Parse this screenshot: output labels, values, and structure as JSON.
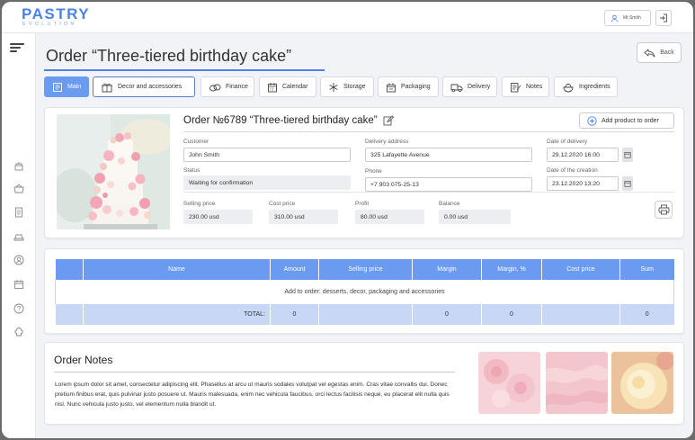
{
  "app": {
    "logo_main": "PASTRY",
    "logo_sub": "EVOLUTION"
  },
  "header": {
    "user_name": "Mr.Smith"
  },
  "page": {
    "title": "Order “Three-tiered birthday cake”",
    "back_label": "Back"
  },
  "tabs": [
    {
      "label": "Main",
      "icon": "order-icon",
      "active": true
    },
    {
      "label": "Decor and accessories",
      "icon": "gift-icon"
    },
    {
      "label": "Finance",
      "icon": "money-icon"
    },
    {
      "label": "Calendar",
      "icon": "calendar-icon"
    },
    {
      "label": "Storage",
      "icon": "snowflake-icon"
    },
    {
      "label": "Packaging",
      "icon": "box-icon"
    },
    {
      "label": "Delivery",
      "icon": "truck-icon"
    },
    {
      "label": "Notes",
      "icon": "notes-icon"
    },
    {
      "label": "Ingredients",
      "icon": "ingredients-icon"
    }
  ],
  "order": {
    "heading": "Order №6789  “Three-tiered birthday cake”",
    "add_product_label": "Add product to order",
    "customer_label": "Customer",
    "customer": "John Smith",
    "status_label": "Status",
    "status": "Waiting for confirmation",
    "address_label": "Delivery address",
    "address": "325 Lafayette Avenue",
    "phone_label": "Phone",
    "phone": "+7 903 075-25-13",
    "delivery_date_label": "Date of delivery",
    "delivery_date": "29.12.2020   16:00",
    "creation_date_label": "Date of the creation",
    "creation_date": "23.12.2020   13:20",
    "selling_price_label": "Selling price",
    "selling_price": "230.00 usd",
    "cost_price_label": "Cost price",
    "cost_price": "310.00 usd",
    "profit_label": "Profit",
    "profit": "80.00 usd",
    "balance_label": "Balance",
    "balance": "0.00 usd"
  },
  "products_table": {
    "columns": [
      "",
      "Name",
      "Amount",
      "Selling price",
      "Margin",
      "Margin, %",
      "Cost price",
      "Sum"
    ],
    "empty_message": "Add to order: desserts, decor, packaging and accessories",
    "total_label": "TOTAL:",
    "totals": {
      "amount": "0",
      "margin": "0",
      "margin_pct": "0",
      "sum": "0"
    }
  },
  "notes": {
    "title": "Order Notes",
    "text": "Lorem ipsum dolor sit amet, consectetur adipiscing elit. Phasellus at arcu ut mauris sodales volutpat vel egestas enim. Cras vitae convallis dui. Donec pretium finibus erat, quis pulvinar justo posuere ut. Mauris malesuada, enim nec vehicula faucibus, orci lectus facilisis neque, eu placerat elit nulla quis nisl. Nunc vehicula justo justo, vel elementum nulla blandit ut."
  },
  "colors": {
    "accent": "#6b9bf0",
    "brand": "#4c82ea",
    "table_total": "#c8d7f5"
  }
}
